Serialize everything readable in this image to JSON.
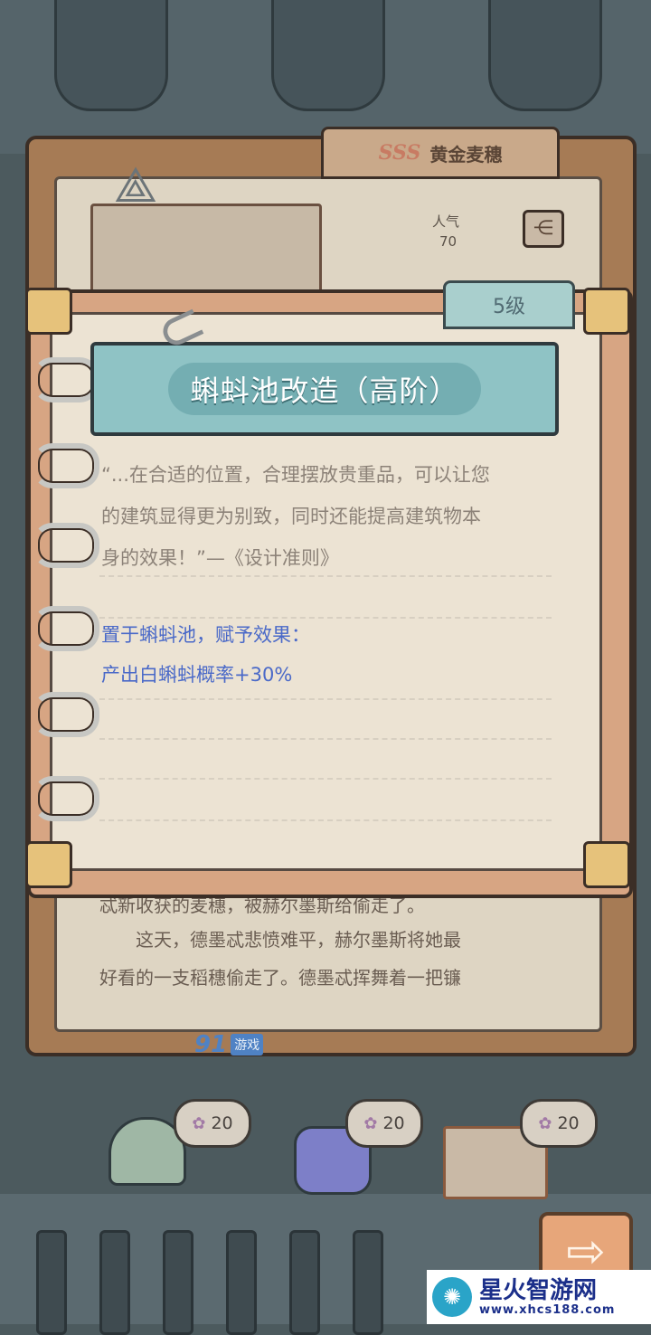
{
  "back_book": {
    "grade_badge": "SSS",
    "item_name": "黄金麦穗",
    "popularity_label": "人气",
    "popularity_value": "70",
    "story_lines": [
      "忒新收获的麦穗，被赫尔墨斯给偷走了。",
      "　　这天，德墨忒悲愤难平，赫尔墨斯将她最",
      "好看的一支稻穗偷走了。德墨忒挥舞着一把镰"
    ]
  },
  "popup": {
    "level_tab": "5级",
    "title": "蝌蚪池改造（高阶）",
    "quote_lines": [
      "“...在合适的位置，合理摆放贵重品，可以让您",
      "的建筑显得更为别致，同时还能提高建筑物本",
      "身的效果！”—《设计准则》"
    ],
    "effect_heading": "置于蝌蚪池，赋予效果：",
    "effect_value": "产出白蝌蚪概率+30%"
  },
  "shelf": {
    "items": [
      {
        "cost": "20"
      },
      {
        "cost": "20"
      },
      {
        "cost": "20"
      }
    ]
  },
  "watermarks": {
    "game_site_num": "91",
    "game_site_text": "游戏",
    "site_name": "星火智游网",
    "site_url": "www.xhcs188.com"
  },
  "colors": {
    "effect_text": "#4a69c8",
    "title_banner": "#8fc3c5",
    "level_tab": "#a9cfcd"
  },
  "icons": [
    "triangle-emblem-icon",
    "share-icon",
    "paperclip-icon",
    "ring-icon",
    "flower-icon",
    "arrow-right-icon"
  ]
}
